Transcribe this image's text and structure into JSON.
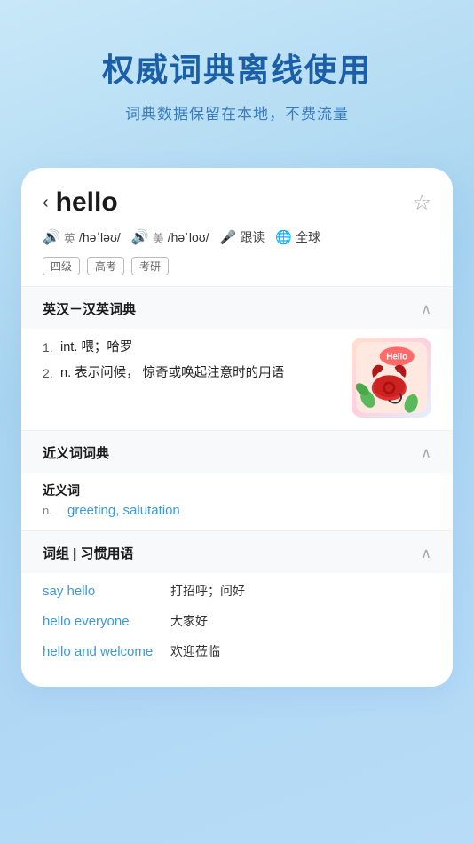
{
  "header": {
    "main_title": "权威词典离线使用",
    "sub_title": "词典数据保留在本地，不费流量"
  },
  "word": {
    "back_label": "‹",
    "word": "hello",
    "star_label": "☆",
    "phonetic_uk_label": "英",
    "phonetic_uk": "/həˈləʊ/",
    "phonetic_us_label": "美",
    "phonetic_us": "/həˈloʊ/",
    "follow_read": "跟读",
    "global": "全球",
    "tags": [
      "四级",
      "高考",
      "考研"
    ]
  },
  "dict_section": {
    "title": "英汉－汉英词典",
    "chevron": "^",
    "entries": [
      {
        "num": "1.",
        "content": "int.  喂；哈罗"
      },
      {
        "num": "2.",
        "content": "n.  表示问候， 惊奇或唤起注意时的用语"
      }
    ]
  },
  "near_section": {
    "title": "近义词词典",
    "chevron": "^",
    "near_title": "近义词",
    "pos": "n.",
    "words": "greeting, salutation"
  },
  "phrase_section": {
    "title": "词组 | 习惯用语",
    "chevron": "^",
    "phrases": [
      {
        "word": "say hello",
        "meaning": "打招呼；问好"
      },
      {
        "word": "hello everyone",
        "meaning": "大家好"
      },
      {
        "word": "hello and welcome",
        "meaning": "欢迎莅临"
      }
    ]
  }
}
